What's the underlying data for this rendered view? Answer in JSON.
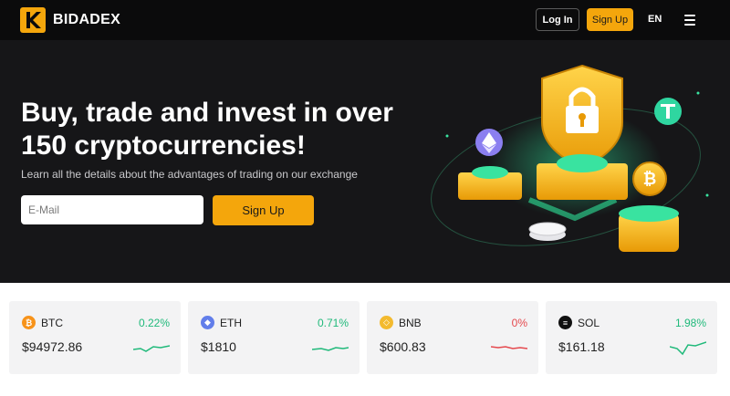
{
  "header": {
    "brand": "BIDADEX",
    "login_label": "Log In",
    "signup_label": "Sign Up",
    "language": "EN",
    "menu_icon": "hamburger-menu-icon"
  },
  "hero": {
    "title": "Buy, trade and invest in over 150 cryptocurrencies!",
    "subtitle": "Learn all the details about the advantages of trading on our exchange",
    "email_placeholder": "E-Mail",
    "signup_label": "Sign Up"
  },
  "tickers": [
    {
      "symbol": "BTC",
      "change": "0.22%",
      "price": "$94972.86",
      "trend": "up",
      "icon_color": "#f7931a",
      "icon": "bitcoin-icon"
    },
    {
      "symbol": "ETH",
      "change": "0.71%",
      "price": "$1810",
      "trend": "up",
      "icon_color": "#627eea",
      "icon": "ethereum-icon"
    },
    {
      "symbol": "BNB",
      "change": "0%",
      "price": "$600.83",
      "trend": "down",
      "icon_color": "#f3ba2f",
      "icon": "binance-icon"
    },
    {
      "symbol": "SOL",
      "change": "1.98%",
      "price": "$161.18",
      "trend": "up",
      "icon_color": "#111111",
      "icon": "solana-icon"
    }
  ],
  "colors": {
    "accent": "#f4a60c",
    "up": "#1fb97a",
    "down": "#e5484d",
    "hero_bg": "#161618",
    "header_bg": "#0b0b0c"
  }
}
